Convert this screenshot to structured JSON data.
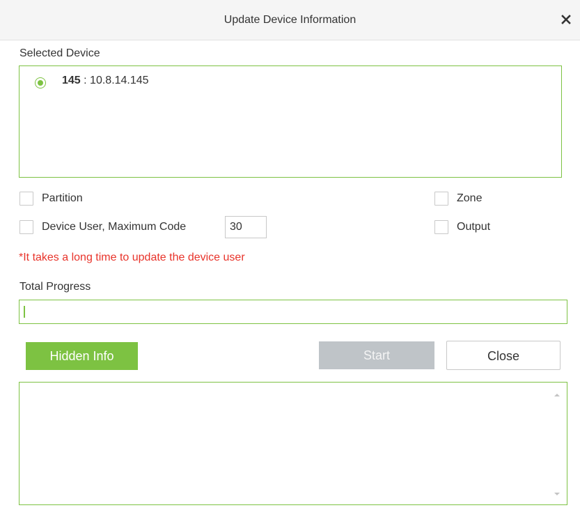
{
  "dialog": {
    "title": "Update Device Information",
    "close_symbol": "×"
  },
  "selected_device": {
    "label": "Selected Device",
    "devices": [
      {
        "name": "145",
        "separator": " : ",
        "ip": "10.8.14.145",
        "selected": true
      }
    ]
  },
  "options": {
    "partition": {
      "label": "Partition",
      "checked": false
    },
    "zone": {
      "label": "Zone",
      "checked": false
    },
    "device_user": {
      "label": "Device User, Maximum Code",
      "checked": false,
      "max_code": "30"
    },
    "output": {
      "label": "Output",
      "checked": false
    }
  },
  "warning": "*It takes a long time to update the device user",
  "progress": {
    "label": "Total Progress",
    "value": 0
  },
  "buttons": {
    "hidden_info": "Hidden Info",
    "start": "Start",
    "close": "Close"
  },
  "log": {
    "content": ""
  },
  "colors": {
    "accent": "#7dc242",
    "warning": "#e8332a",
    "disabled": "#bfc4c8",
    "titlebar": "#f5f5f5"
  },
  "icons": {
    "close": "close-icon",
    "radio": "radio-selected-icon",
    "scroll_up": "scroll-up-arrow-icon",
    "scroll_down": "scroll-down-arrow-icon"
  }
}
